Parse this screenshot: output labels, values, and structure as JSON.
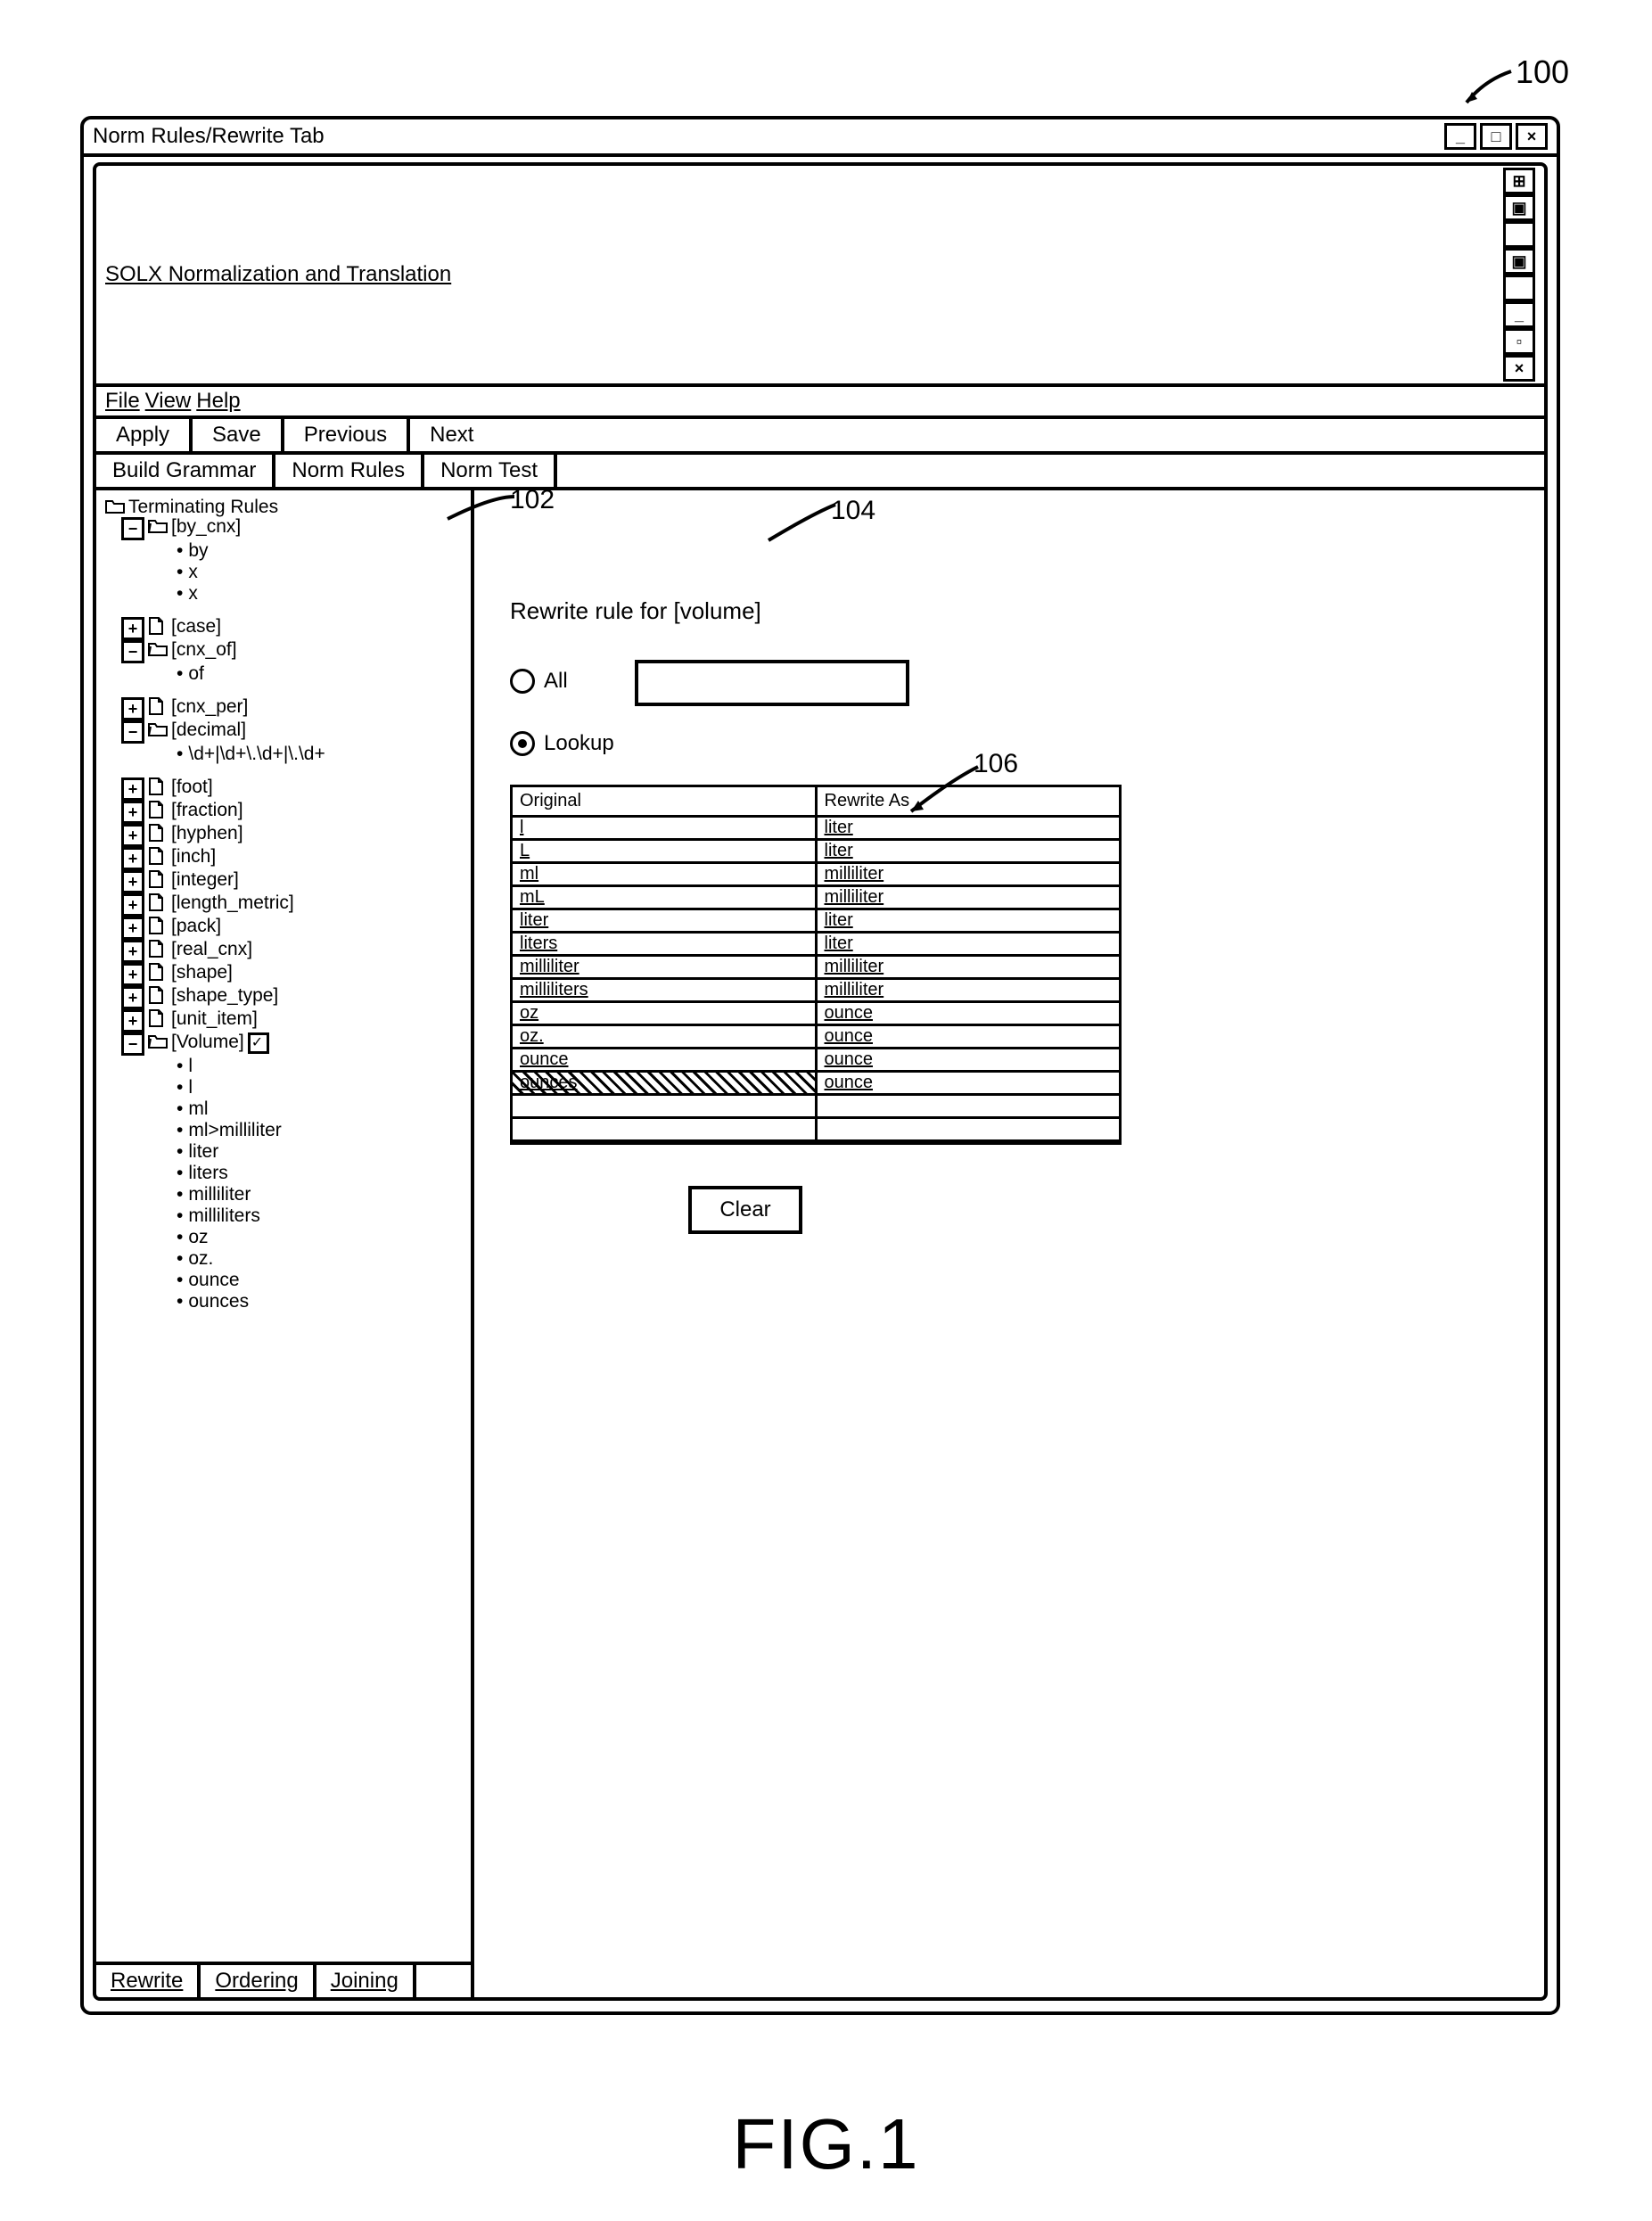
{
  "figure_label": "FIG.1",
  "callouts": {
    "c100": "100",
    "c102": "102",
    "c104": "104",
    "c106": "106"
  },
  "window_title": "Norm Rules/Rewrite Tab",
  "inner_title": "SOLX Normalization and Translation",
  "menu": {
    "file": "File",
    "view": "View",
    "help": "Help"
  },
  "toolbar": {
    "apply": "Apply",
    "save": "Save",
    "previous": "Previous",
    "next": "Next"
  },
  "tabs": {
    "build_grammar": "Build Grammar",
    "norm_rules": "Norm Rules",
    "norm_test": "Norm Test"
  },
  "tree_root": "Terminating Rules",
  "tree": {
    "by_cnx": {
      "label": "[by_cnx]",
      "children": [
        "by",
        "x",
        "x"
      ]
    },
    "case": "[case]",
    "cnx_of": {
      "label": "[cnx_of]",
      "children": [
        "of"
      ]
    },
    "cnx_per": "[cnx_per]",
    "decimal": {
      "label": "[decimal]",
      "children": [
        "\\d+|\\d+\\.\\d+|\\.\\d+"
      ]
    },
    "foot": "[foot]",
    "fraction": "[fraction]",
    "hyphen": "[hyphen]",
    "inch": "[inch]",
    "integer": "[integer]",
    "length_metric": "[length_metric]",
    "pack": "[pack]",
    "real_cnx": "[real_cnx]",
    "shape": "[shape]",
    "shape_type": "[shape_type]",
    "unit_item": "[unit_item]",
    "volume": {
      "label": "[Volume]",
      "checked": true,
      "children": [
        "l",
        "l",
        "ml",
        "ml>milliliter",
        "liter",
        "liters",
        "milliliter",
        "milliliters",
        "oz",
        "oz.",
        "ounce",
        "ounces"
      ]
    }
  },
  "bottom_tabs": {
    "rewrite": "Rewrite",
    "ordering": "Ordering",
    "joining": "Joining"
  },
  "right": {
    "heading": "Rewrite rule for [volume]",
    "opt_all": "All",
    "opt_lookup": "Lookup",
    "col_original": "Original",
    "col_rewrite": "Rewrite As",
    "rows": [
      {
        "o": "l",
        "r": "liter"
      },
      {
        "o": "L",
        "r": "liter"
      },
      {
        "o": "ml",
        "r": "milliliter"
      },
      {
        "o": "mL",
        "r": "milliliter"
      },
      {
        "o": "liter",
        "r": "liter"
      },
      {
        "o": "liters",
        "r": "liter"
      },
      {
        "o": "milliliter",
        "r": "milliliter"
      },
      {
        "o": "milliliters",
        "r": "milliliter"
      },
      {
        "o": "oz",
        "r": "ounce"
      },
      {
        "o": "oz.",
        "r": "ounce"
      },
      {
        "o": "ounce",
        "r": "ounce"
      },
      {
        "o": "ounces",
        "r": "ounce",
        "hatched": true
      }
    ],
    "clear": "Clear"
  }
}
